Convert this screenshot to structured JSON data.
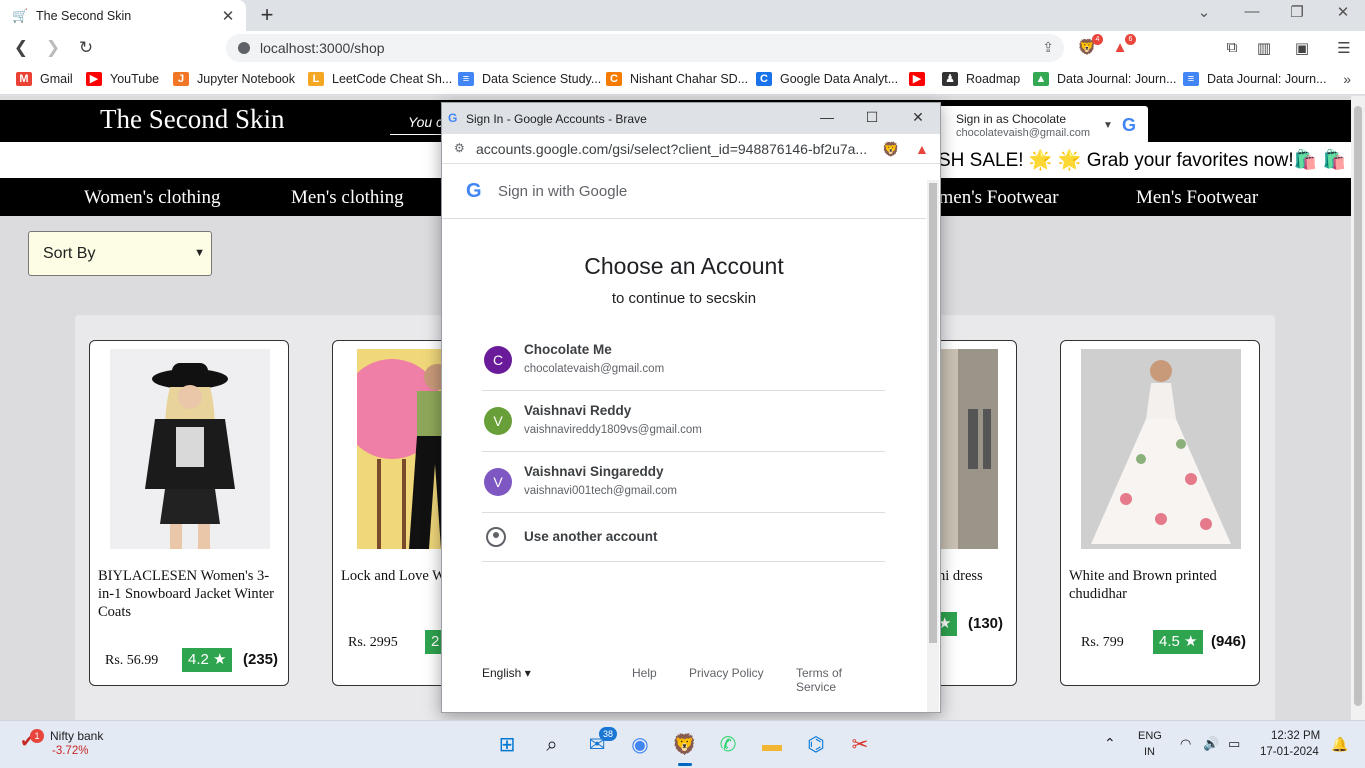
{
  "browser": {
    "tab_title": "The Second Skin",
    "url": "localhost:3000/shop",
    "new_tab": "+",
    "ext_badges": {
      "brave": "4",
      "rewards": "6"
    },
    "bookmarks": [
      {
        "label": "Gmail",
        "icon": "gmail-icon",
        "color": "#ea4335",
        "glyph": "M"
      },
      {
        "label": "YouTube",
        "icon": "youtube-icon",
        "color": "#ff0000",
        "glyph": "▶"
      },
      {
        "label": "Jupyter Notebook",
        "icon": "jupyter-icon",
        "color": "#f37626",
        "glyph": "J"
      },
      {
        "label": "LeetCode Cheat Sh...",
        "icon": "leetcode-icon",
        "color": "#f5a623",
        "glyph": "L"
      },
      {
        "label": "Data Science Study...",
        "icon": "docs-icon",
        "color": "#4285f4",
        "glyph": "≡"
      },
      {
        "label": "Nishant Chahar SD...",
        "icon": "codeforces-icon",
        "color": "#f57c00",
        "glyph": "C"
      },
      {
        "label": "Google Data Analyt...",
        "icon": "coursera-icon",
        "color": "#1a73e8",
        "glyph": "C"
      },
      {
        "label": "",
        "icon": "youtube-icon",
        "color": "#ff0000",
        "glyph": "▶"
      },
      {
        "label": "Roadmap",
        "icon": "roadmap-icon",
        "color": "#333333",
        "glyph": "♟"
      },
      {
        "label": "Data Journal: Journ...",
        "icon": "drive-icon",
        "color": "#34a853",
        "glyph": "▲"
      },
      {
        "label": "Data Journal: Journ...",
        "icon": "docs-icon",
        "color": "#4285f4",
        "glyph": "≡"
      }
    ],
    "bookmarks_more": "»"
  },
  "site": {
    "brand": "The Second Skin",
    "search_hint": "You c",
    "sale_text": "SH SALE! 🌟 🌟 Grab your favorites now!🛍️ 🛍️ H",
    "categories": [
      "Women's clothing",
      "Men's clothing",
      "omen's Footwear",
      "Men's Footwear"
    ],
    "sort_label": "Sort By",
    "signed_in": {
      "line1": "Sign in as Chocolate",
      "line2": "chocolatevaish@gmail.com"
    },
    "products": [
      {
        "name": "BIYLACLESEN Women's 3-in-1 Snowboard Jacket Winter Coats",
        "price": "Rs. 56.99",
        "rating": "4.2",
        "count": "(235)"
      },
      {
        "name": "Lock and Love W Black Denim",
        "price": "Rs. 2995",
        "rating": "2",
        "count": ""
      },
      {
        "name": "hi dress",
        "price": "",
        "rating": "",
        "count": "(130)"
      },
      {
        "name": "White and Brown printed chudidhar",
        "price": "Rs. 799",
        "rating": "4.5",
        "count": "(946)"
      }
    ]
  },
  "popup": {
    "window_title": "Sign In - Google Accounts - Brave",
    "url": "accounts.google.com/gsi/select?client_id=948876146-bf2u7a...",
    "header": "Sign in with Google",
    "heading": "Choose an Account",
    "subheading": "to continue to secskin",
    "accounts": [
      {
        "initial": "C",
        "name": "Chocolate Me",
        "email": "chocolatevaish@gmail.com",
        "color": "#6a1b9a"
      },
      {
        "initial": "V",
        "name": "Vaishnavi Reddy",
        "email": "vaishnavireddy1809vs@gmail.com",
        "color": "#689f38"
      },
      {
        "initial": "V",
        "name": "Vaishnavi Singareddy",
        "email": "vaishnavi001tech@gmail.com",
        "color": "#7e57c2"
      }
    ],
    "use_another": "Use another account",
    "language": "English",
    "help": "Help",
    "privacy": "Privacy Policy",
    "terms": "Terms of Service"
  },
  "taskbar": {
    "widget_title": "Nifty bank",
    "widget_value": "-3.72%",
    "widget_badge": "1",
    "mail_badge": "38",
    "lang1": "ENG",
    "lang2": "IN",
    "time": "12:32 PM",
    "date": "17-01-2024"
  },
  "colors": {
    "accent": "#1a73e8",
    "rating_green": "#2ea44f",
    "nav_black": "#000000"
  }
}
